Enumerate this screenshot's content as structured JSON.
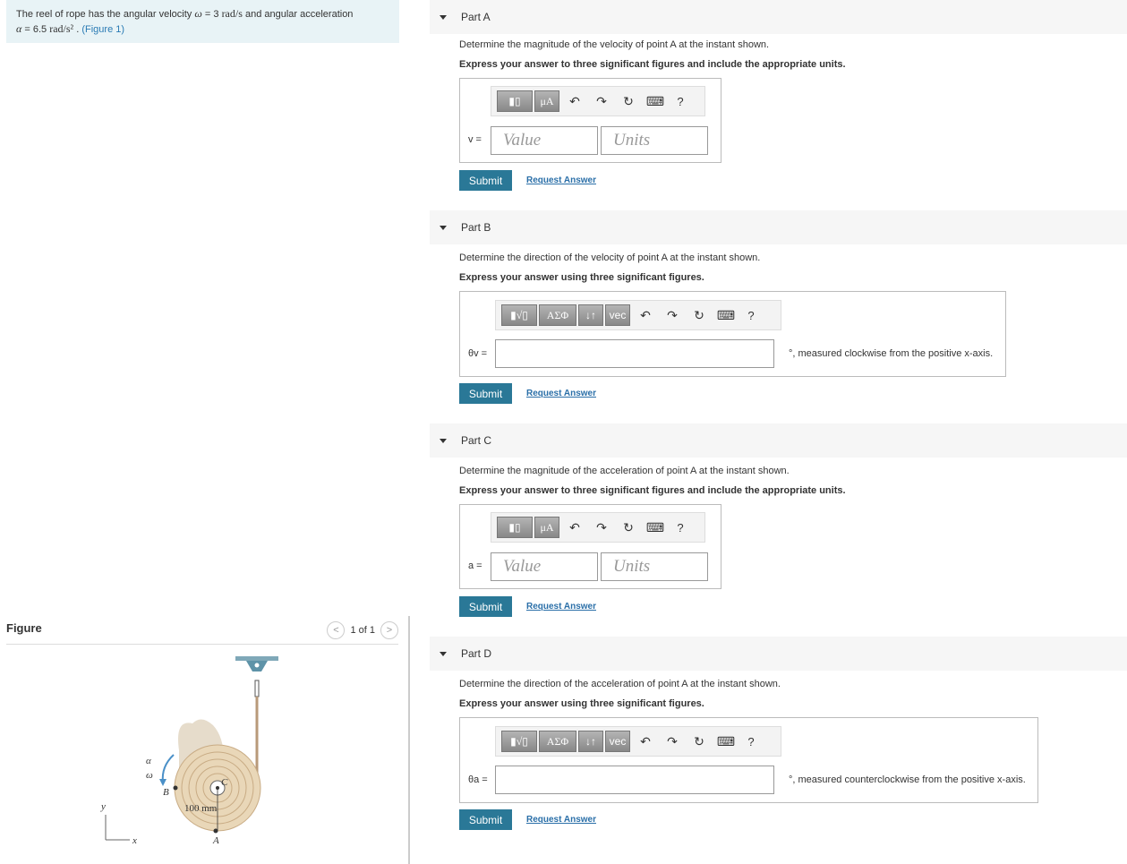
{
  "problem": {
    "text_before": "The reel of rope has the angular velocity",
    "omega_sym": "ω",
    "omega_eq": "= 3",
    "omega_unit": "rad/s",
    "text_mid": "and angular acceleration",
    "alpha_sym": "α",
    "alpha_eq": "= 6.5",
    "alpha_unit": "rad/s²",
    "dot": ".",
    "figure_link": "(Figure 1)"
  },
  "figure": {
    "title": "Figure",
    "pager": "1 of 1",
    "prev": "<",
    "next": ">",
    "labels": {
      "alpha": "α",
      "omega": "ω",
      "B": "B",
      "C": "C",
      "A": "A",
      "y": "y",
      "x": "x",
      "dim": "100 mm"
    }
  },
  "toolbar": {
    "mu": "μA",
    "greek": "ΑΣΦ",
    "arrows": "↓↑",
    "vec": "vec",
    "undo": "↶",
    "redo": "↷",
    "reset": "↻",
    "help": "?"
  },
  "parts": [
    {
      "title": "Part A",
      "question": "Determine the magnitude of the velocity of point A at the instant shown.",
      "instruction": "Express your answer to three significant figures and include the appropriate units.",
      "label": "v =",
      "value_placeholder": "Value",
      "units_placeholder": "Units",
      "submit": "Submit",
      "request": "Request Answer"
    },
    {
      "title": "Part B",
      "question": "Determine the direction of the velocity of point A at the instant shown.",
      "instruction": "Express your answer using three significant figures.",
      "label": "θv =",
      "suffix": "°, measured clockwise from the positive x-axis.",
      "submit": "Submit",
      "request": "Request Answer"
    },
    {
      "title": "Part C",
      "question": "Determine the magnitude of the acceleration of point A at the instant shown.",
      "instruction": "Express your answer to three significant figures and include the appropriate units.",
      "label": "a =",
      "value_placeholder": "Value",
      "units_placeholder": "Units",
      "submit": "Submit",
      "request": "Request Answer"
    },
    {
      "title": "Part D",
      "question": "Determine the direction of the acceleration of point A at the instant shown.",
      "instruction": "Express your answer using three significant figures.",
      "label": "θa =",
      "suffix": "°, measured counterclockwise from the positive x-axis.",
      "submit": "Submit",
      "request": "Request Answer"
    }
  ]
}
